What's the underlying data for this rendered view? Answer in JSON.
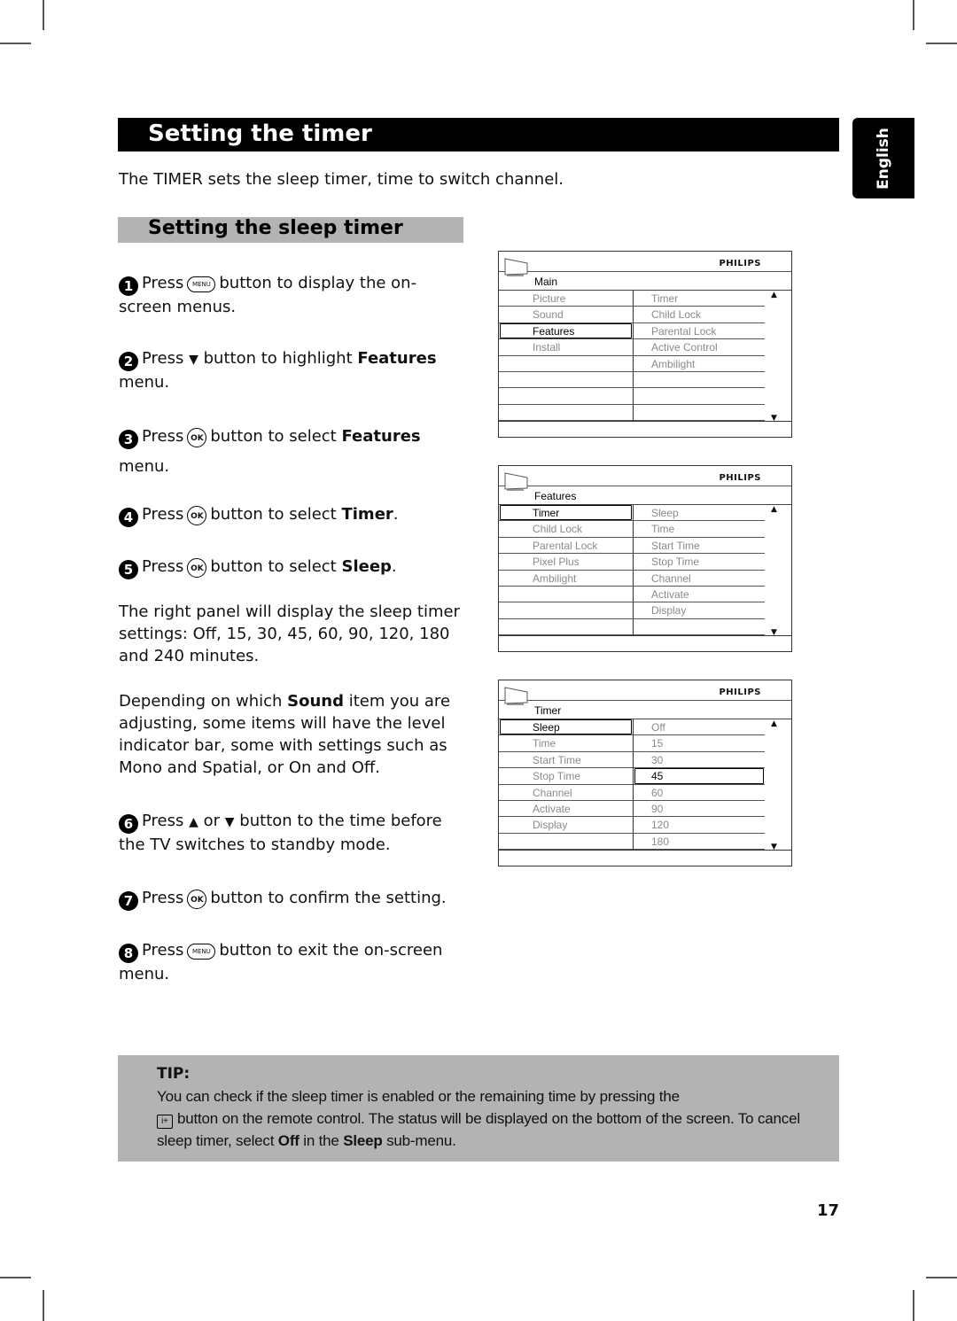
{
  "header": {
    "title": "Setting the timer",
    "language_tab": "English",
    "intro": "The TIMER sets the sleep timer, time to switch channel."
  },
  "section": {
    "title": "Setting the sleep timer"
  },
  "steps": [
    {
      "num": "1",
      "pre": "Press",
      "button": "MENU",
      "text": "button to display the on-screen menus."
    },
    {
      "num": "2",
      "pre": "Press",
      "button": "▼",
      "text": "button to highlight",
      "bold": "Features",
      "post": "menu."
    },
    {
      "num": "3",
      "pre": "Press",
      "button": "OK",
      "text": "button to select",
      "bold": "Features",
      "post": "menu."
    },
    {
      "num": "4",
      "pre": "Press",
      "button": "OK",
      "text": "button to select",
      "bold": "Timer",
      "post": "."
    },
    {
      "num": "5",
      "pre": "Press",
      "button": "OK",
      "text": "button to select",
      "bold": "Sleep",
      "post": "."
    },
    {
      "num": "6",
      "pre": "Press",
      "button_up": "▲",
      "or": "or",
      "button": "▼",
      "text": "button to the time before the TV switches to standby mode."
    },
    {
      "num": "7",
      "pre": "Press",
      "button": "OK",
      "text": "button to confirm the setting."
    },
    {
      "num": "8",
      "pre": "Press",
      "button": "MENU",
      "text": "button to exit the on-screen menu."
    }
  ],
  "notes": {
    "right_panel": "The right panel will display the sleep timer settings: Off, 15, 30, 45, 60, 90, 120, 180 and 240 minutes.",
    "depending_pre": "Depending on which",
    "depending_bold": "Sound",
    "depending_post": "item you are adjusting, some items will have the level indicator bar, some with settings such as Mono and Spatial, or On and Off."
  },
  "menus": [
    {
      "brand": "PHILIPS",
      "breadcrumb": "Main",
      "left": [
        "Picture",
        "Sound",
        "Features",
        "Install",
        "",
        "",
        "",
        ""
      ],
      "left_selected": 2,
      "right": [
        "Timer",
        "Child Lock",
        "Parental Lock",
        "Active Control",
        "Ambilight",
        "",
        "",
        ""
      ],
      "right_selected": -1
    },
    {
      "brand": "PHILIPS",
      "breadcrumb": "Features",
      "left": [
        "Timer",
        "Child Lock",
        "Parental Lock",
        "Pixel Plus",
        "Ambilight",
        "",
        "",
        ""
      ],
      "left_selected": 0,
      "right": [
        "Sleep",
        "Time",
        "Start Time",
        "Stop Time",
        "Channel",
        "Activate",
        "Display",
        ""
      ],
      "right_selected": -1
    },
    {
      "brand": "PHILIPS",
      "breadcrumb": "Timer",
      "left": [
        "Sleep",
        "Time",
        "Start Time",
        "Stop Time",
        "Channel",
        "Activate",
        "Display",
        ""
      ],
      "left_selected": 0,
      "right": [
        "Off",
        "15",
        "30",
        "45",
        "60",
        "90",
        "120",
        "180"
      ],
      "right_selected": 3
    }
  ],
  "scroll_up": "▲",
  "scroll_down": "▼",
  "tip": {
    "title": "TIP:",
    "line1": "You can check if the sleep timer is enabled or the remaining time by pressing the",
    "info_button": "i+",
    "line2": "button on the remote control. The status will be displayed on the bottom of the screen. To cancel sleep timer, select",
    "bold1": "Off",
    "mid": "in the",
    "bold2": "Sleep",
    "end": "sub-menu."
  },
  "page_number": "17"
}
